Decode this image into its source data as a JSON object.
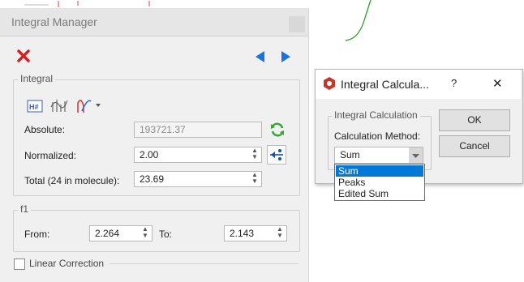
{
  "integral_manager": {
    "title": "Integral Manager",
    "integral_group_label": "Integral",
    "absolute_label": "Absolute:",
    "absolute_value": "193721.37",
    "normalized_label": "Normalized:",
    "normalized_value": "2.00",
    "total_label": "Total (24 in molecule):",
    "total_value": "23.69",
    "f1_group_label": "f1",
    "from_label": "From:",
    "from_value": "2.264",
    "to_label": "To:",
    "to_value": "2.143",
    "linear_correction_label": "Linear Correction"
  },
  "dialog": {
    "title": "Integral Calcula...",
    "help_label": "?",
    "close_label": "✕",
    "group_label": "Integral Calculation",
    "method_label": "Calculation Method:",
    "selected_value": "Sum",
    "options": [
      "Sum",
      "Peaks",
      "Edited Sum"
    ],
    "ok_label": "OK",
    "cancel_label": "Cancel"
  },
  "colors": {
    "delete_red": "#d42020",
    "nav_blue": "#1a73d9",
    "refresh_green": "#3aa53a",
    "highlight": "#0078d7",
    "trace_green": "#2e9e2e"
  },
  "icons": [
    "delete-icon",
    "prev-arrow-icon",
    "next-arrow-icon",
    "integral-table-icon",
    "integral-bars-icon",
    "integral-curve-icon",
    "refresh-icon",
    "normalize-icon",
    "integral-calc-app-icon"
  ]
}
